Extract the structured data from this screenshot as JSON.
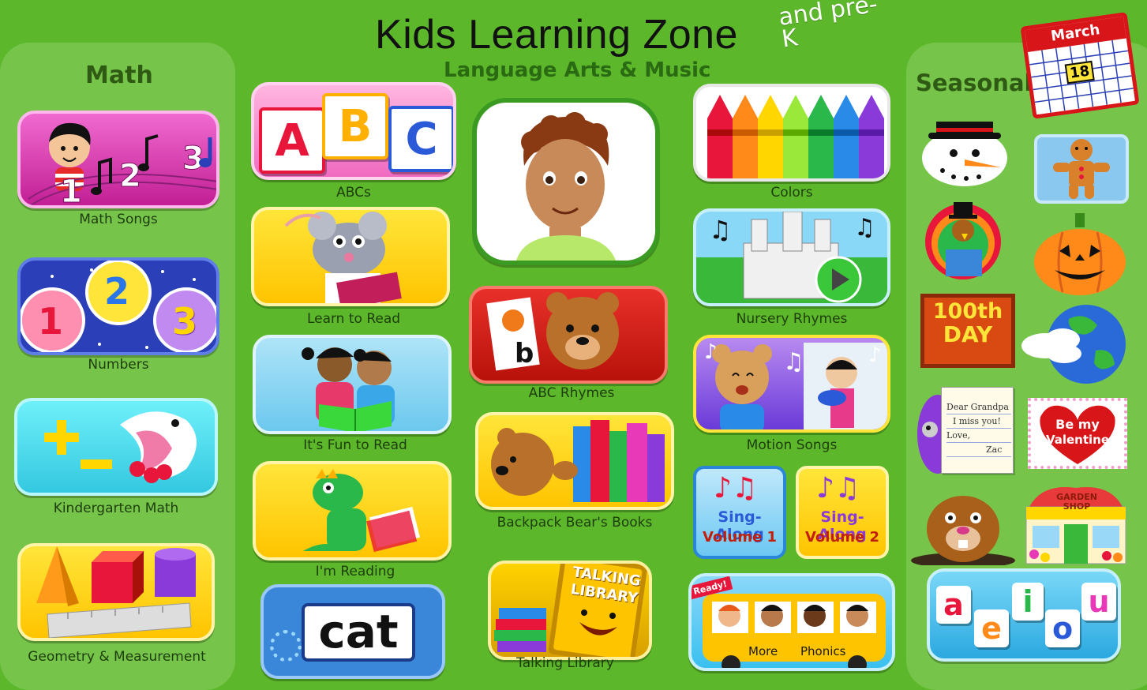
{
  "header": {
    "title": "Kids Learning Zone",
    "badge": "and pre-K"
  },
  "math": {
    "heading": "Math",
    "items": [
      {
        "label": "Math Songs"
      },
      {
        "label": "Numbers"
      },
      {
        "label": "Kindergarten Math"
      },
      {
        "label": "Geometry & Measurement"
      }
    ],
    "digits": [
      "1",
      "2",
      "3"
    ]
  },
  "language": {
    "heading": "Language Arts & Music",
    "col1": [
      {
        "label": "ABCs"
      },
      {
        "label": "Learn to Read"
      },
      {
        "label": "It's Fun to Read"
      },
      {
        "label": "I'm Reading"
      }
    ],
    "col2": [
      {
        "label": "ABC Rhymes"
      },
      {
        "label": "Backpack Bear's Books"
      },
      {
        "label": "Talking Library"
      }
    ],
    "col3": [
      {
        "label": "Colors"
      },
      {
        "label": "Nursery Rhymes"
      },
      {
        "label": "Motion Songs"
      }
    ],
    "abc_letters": [
      "A",
      "B",
      "C"
    ],
    "cat_word": "cat",
    "abc_rhymes_letter": "b",
    "library_sign": "TALKING LIBRARY",
    "sing_along_1": {
      "line1": "Sing-Along",
      "line2": "Volume 1"
    },
    "sing_along_2": {
      "line1": "Sing-Along",
      "line2": "Volume 2"
    },
    "bus": {
      "flag": "Ready!",
      "more": "More",
      "phonics": "Phonics"
    }
  },
  "seasonal": {
    "heading": "Seasonal",
    "calendar_month": "March",
    "calendar_day": "18",
    "hundredth_day": {
      "line1": "100th",
      "line2": "DAY"
    },
    "valentine": {
      "line1": "Be my",
      "line2": "Valentine"
    },
    "letter": {
      "line1": "Dear Grandpa",
      "line2": "I miss you!",
      "line3": "Love,",
      "line4": "Zac"
    },
    "garden_shop": "GARDEN SHOP",
    "vowels": [
      "a",
      "e",
      "i",
      "o",
      "u"
    ]
  },
  "colors": {
    "bg": "#5cb82a",
    "panel": "#76c54a",
    "pink": "#e83aa8",
    "blue": "#2a3fb8",
    "cyan": "#3fd4e6",
    "yellow": "#ffd600",
    "red": "#d62a1a"
  }
}
